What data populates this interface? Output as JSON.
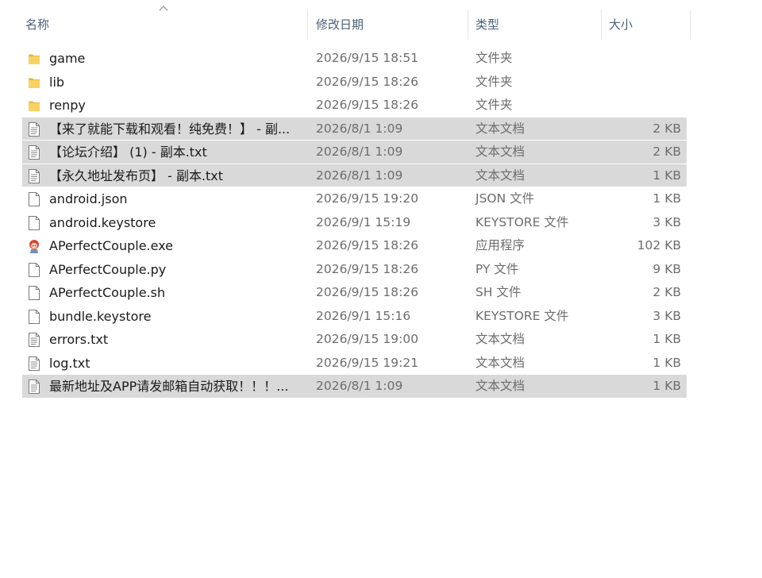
{
  "header": {
    "name": "名称",
    "date": "修改日期",
    "type": "类型",
    "size": "大小"
  },
  "colors": {
    "folder": "#f8d262",
    "selected_row": "#d9d9d9"
  },
  "files": [
    {
      "name": "game",
      "date": "2026/9/15 18:51",
      "type": "文件夹",
      "size": "",
      "icon": "folder-icon",
      "selected": false
    },
    {
      "name": "lib",
      "date": "2026/9/15 18:26",
      "type": "文件夹",
      "size": "",
      "icon": "folder-icon",
      "selected": false
    },
    {
      "name": "renpy",
      "date": "2026/9/15 18:26",
      "type": "文件夹",
      "size": "",
      "icon": "folder-icon",
      "selected": false
    },
    {
      "name": "【来了就能下载和观看！纯免费！】 - 副...",
      "date": "2026/8/1 1:09",
      "type": "文本文档",
      "size": "2 KB",
      "icon": "text-document-icon",
      "selected": true
    },
    {
      "name": "【论坛介绍】 (1) - 副本.txt",
      "date": "2026/8/1 1:09",
      "type": "文本文档",
      "size": "2 KB",
      "icon": "text-document-icon",
      "selected": true
    },
    {
      "name": "【永久地址发布页】 - 副本.txt",
      "date": "2026/8/1 1:09",
      "type": "文本文档",
      "size": "1 KB",
      "icon": "text-document-icon",
      "selected": true
    },
    {
      "name": "android.json",
      "date": "2026/9/15 19:20",
      "type": "JSON 文件",
      "size": "1 KB",
      "icon": "blank-file-icon",
      "selected": false
    },
    {
      "name": "android.keystore",
      "date": "2026/9/1 15:19",
      "type": "KEYSTORE 文件",
      "size": "3 KB",
      "icon": "blank-file-icon",
      "selected": false
    },
    {
      "name": "APerfectCouple.exe",
      "date": "2026/9/15 18:26",
      "type": "应用程序",
      "size": "102 KB",
      "icon": "app-exe-icon",
      "selected": false
    },
    {
      "name": "APerfectCouple.py",
      "date": "2026/9/15 18:26",
      "type": "PY 文件",
      "size": "9 KB",
      "icon": "blank-file-icon",
      "selected": false
    },
    {
      "name": "APerfectCouple.sh",
      "date": "2026/9/15 18:26",
      "type": "SH 文件",
      "size": "2 KB",
      "icon": "blank-file-icon",
      "selected": false
    },
    {
      "name": "bundle.keystore",
      "date": "2026/9/1 15:16",
      "type": "KEYSTORE 文件",
      "size": "3 KB",
      "icon": "blank-file-icon",
      "selected": false
    },
    {
      "name": "errors.txt",
      "date": "2026/9/15 19:00",
      "type": "文本文档",
      "size": "1 KB",
      "icon": "text-document-icon",
      "selected": false
    },
    {
      "name": "log.txt",
      "date": "2026/9/15 19:21",
      "type": "文本文档",
      "size": "1 KB",
      "icon": "text-document-icon",
      "selected": false
    },
    {
      "name": "最新地址及APP请发邮箱自动获取！！！...",
      "date": "2026/8/1 1:09",
      "type": "文本文档",
      "size": "1 KB",
      "icon": "text-document-icon",
      "selected": true
    }
  ]
}
